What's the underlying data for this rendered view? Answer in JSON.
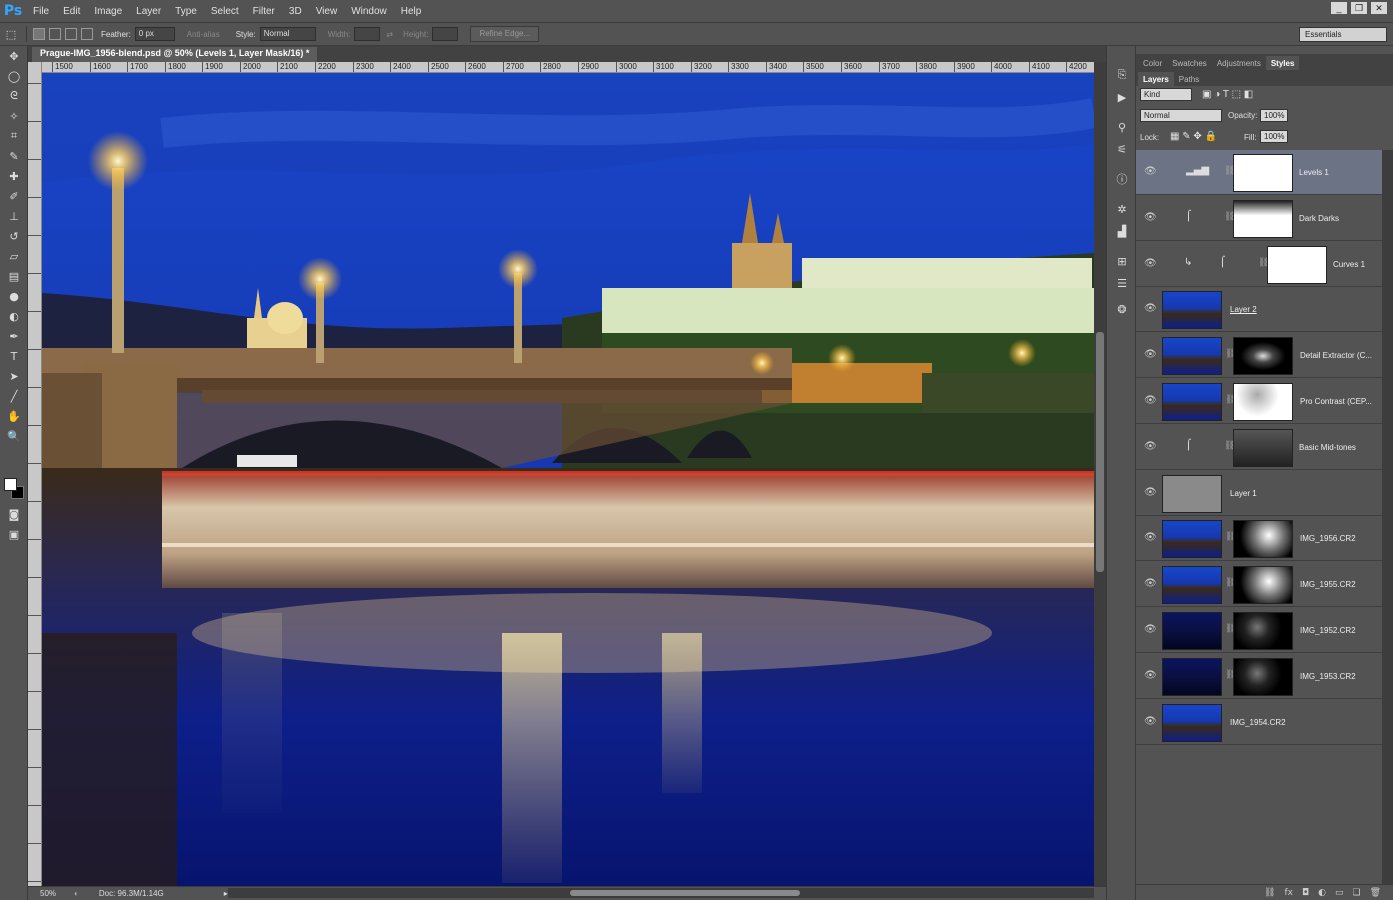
{
  "app": {
    "logo": "Ps"
  },
  "menu": [
    "File",
    "Edit",
    "Image",
    "Layer",
    "Type",
    "Select",
    "Filter",
    "3D",
    "View",
    "Window",
    "Help"
  ],
  "window_controls": [
    "_",
    "❐",
    "✕"
  ],
  "options": {
    "feather_label": "Feather:",
    "feather_value": "0 px",
    "antialias_label": "Anti-alias",
    "style_label": "Style:",
    "style_value": "Normal",
    "width_label": "Width:",
    "height_label": "Height:",
    "refine_edge": "Refine Edge...",
    "workspace": "Essentials"
  },
  "document": {
    "tab_title": "Prague-IMG_1956-blend.psd @ 50% (Levels 1, Layer Mask/16) *",
    "ruler_ticks": [
      "1500",
      "1600",
      "1700",
      "1800",
      "1900",
      "2000",
      "2100",
      "2200",
      "2300",
      "2400",
      "2500",
      "2600",
      "2700",
      "2800",
      "2900",
      "3000",
      "3100",
      "3200",
      "3300",
      "3400",
      "3500",
      "3600",
      "3700",
      "3800",
      "3900",
      "4000",
      "4100",
      "4200"
    ],
    "zoom": "50%",
    "doc_size": "Doc: 96.3M/1.14G"
  },
  "panels": {
    "top_tabs": [
      "Color",
      "Swatches",
      "Adjustments",
      "Styles"
    ],
    "active_top_tab": "Styles",
    "layer_tabs": [
      "Layers",
      "Paths"
    ],
    "filter_kind": "Kind",
    "blend_mode": "Normal",
    "opacity_label": "Opacity:",
    "opacity_value": "100%",
    "lock_label": "Lock:",
    "fill_label": "Fill:",
    "fill_value": "100%"
  },
  "layers": [
    {
      "name": "Levels 1",
      "type": "adjustment",
      "icon": "levels-icon",
      "selected": true
    },
    {
      "name": "Dark Darks",
      "type": "adjustment",
      "icon": "curves-icon"
    },
    {
      "name": "Curves 1",
      "type": "adjustment-clipped",
      "icon": "curves-icon"
    },
    {
      "name": "Layer 2",
      "type": "pixel"
    },
    {
      "name": "Detail Extractor (C...",
      "type": "pixel-mask"
    },
    {
      "name": "Pro Contrast (CEP...",
      "type": "pixel-mask"
    },
    {
      "name": "Basic Mid-tones",
      "type": "adjustment",
      "icon": "curves-icon"
    },
    {
      "name": "Layer 1",
      "type": "gray"
    },
    {
      "name": "IMG_1956.CR2",
      "type": "pixel-mask"
    },
    {
      "name": "IMG_1955.CR2",
      "type": "pixel-mask"
    },
    {
      "name": "IMG_1952.CR2",
      "type": "pixel-mask"
    },
    {
      "name": "IMG_1953.CR2",
      "type": "pixel-mask"
    },
    {
      "name": "IMG_1954.CR2",
      "type": "pixel"
    }
  ]
}
